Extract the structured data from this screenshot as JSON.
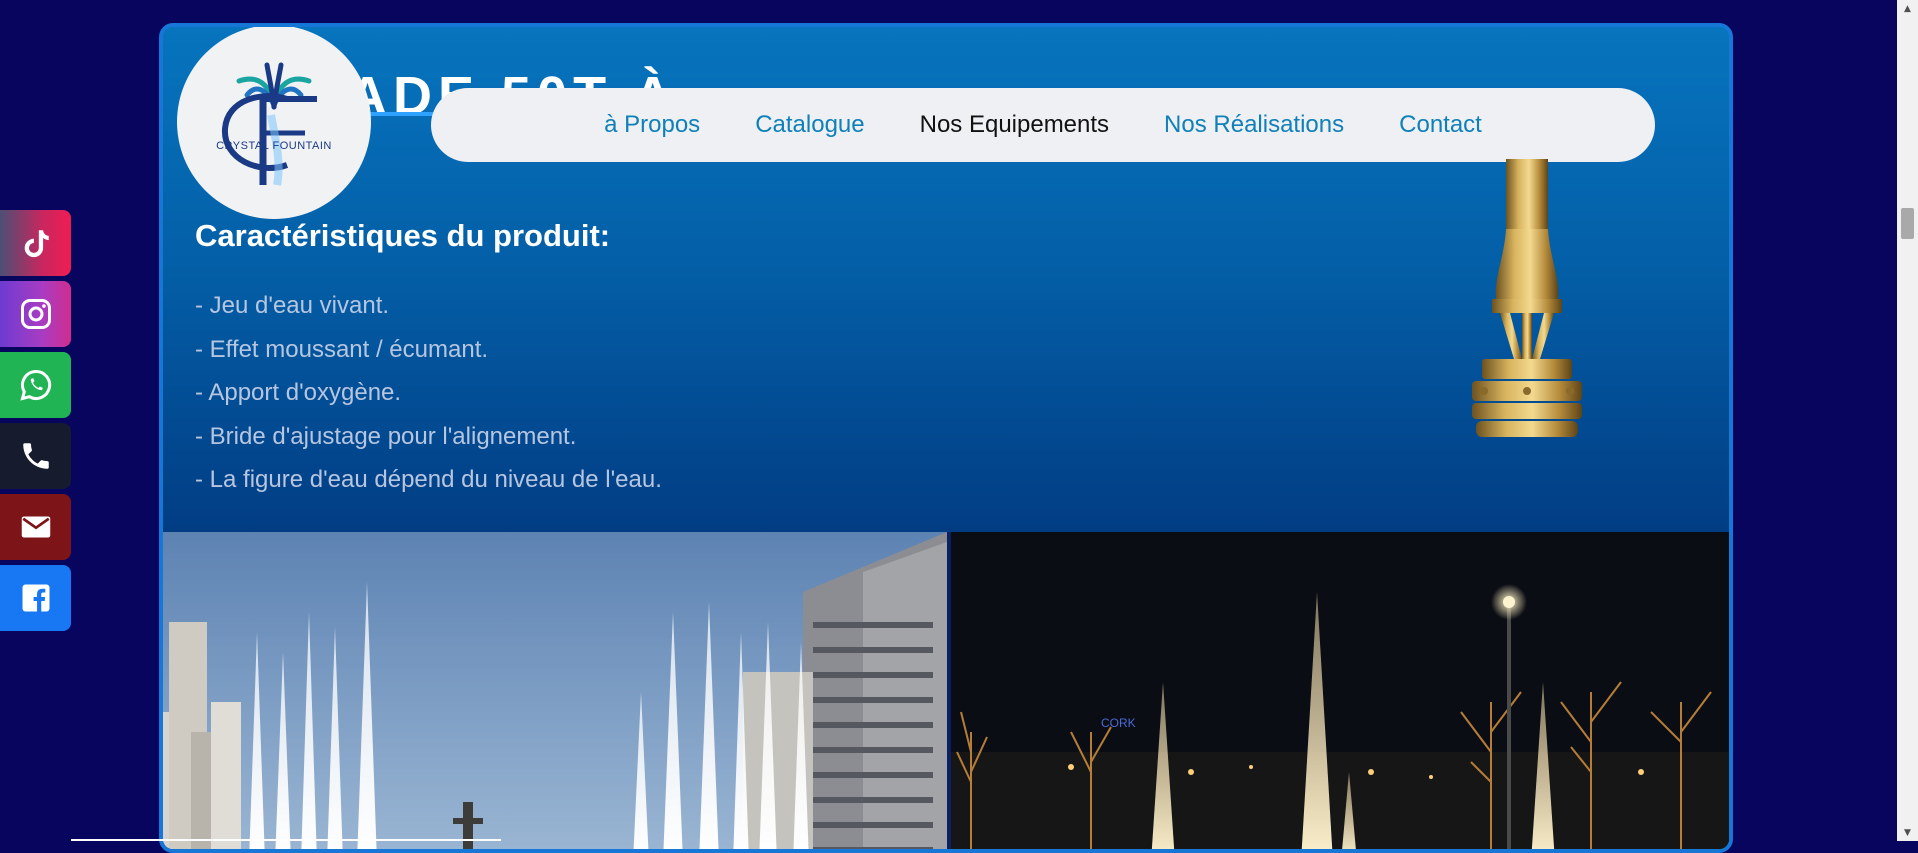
{
  "header": {
    "background_title": "ADE 50T À",
    "logo_text": "CRYSTAL FOUNTAIN",
    "logo_monogram": "CF"
  },
  "nav": {
    "items": [
      {
        "label": "à Propos",
        "active": false
      },
      {
        "label": "Catalogue",
        "active": false
      },
      {
        "label": "Nos Equipements",
        "active": true
      },
      {
        "label": "Nos Réalisations",
        "active": false
      },
      {
        "label": "Contact",
        "active": false
      }
    ]
  },
  "product": {
    "features_title": "Caractéristiques du produit:",
    "features": [
      "- Jeu d'eau vivant.",
      "- Effet moussant / écumant.",
      "- Apport d'oxygène.",
      "- Bride d'ajustage pour l'alignement.",
      "- La figure d'eau dépend du niveau de l'eau."
    ]
  },
  "photos": {
    "left_alt": "fountain-daytime-city",
    "right_alt": "fountain-night-lit"
  },
  "social": [
    {
      "name": "tiktok",
      "icon": "tiktok-icon",
      "color": "#ee1d52"
    },
    {
      "name": "instagram",
      "icon": "instagram-icon",
      "color": "#a93cc2"
    },
    {
      "name": "whatsapp",
      "icon": "whatsapp-icon",
      "color": "#20b455"
    },
    {
      "name": "phone",
      "icon": "phone-icon",
      "color": "#161b2e"
    },
    {
      "name": "email",
      "icon": "email-icon",
      "color": "#7d1417"
    },
    {
      "name": "facebook",
      "icon": "facebook-icon",
      "color": "#1877f2"
    }
  ],
  "colors": {
    "page_background": "#07055e",
    "card_gradient_top": "#0774be",
    "card_gradient_bottom": "#012c6f",
    "nav_link": "#1080b9",
    "nav_active": "#111111",
    "feature_text": "#b7c6e0"
  }
}
